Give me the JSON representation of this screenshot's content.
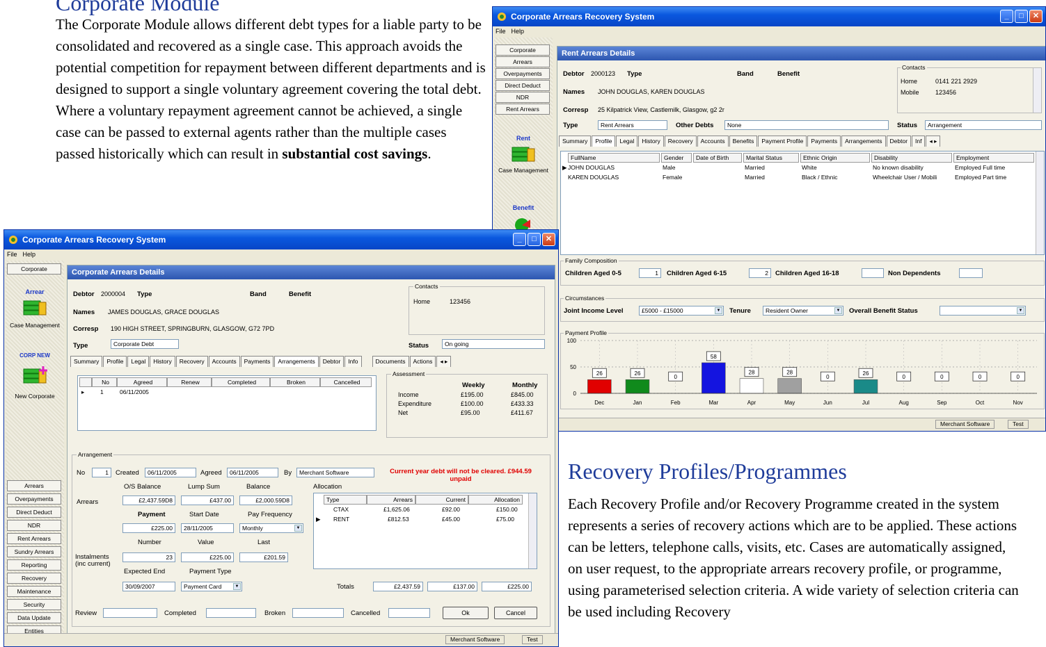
{
  "doc": {
    "heading1": "Corporate Module",
    "para1_before": "The Corporate Module allows different debt types for a liable party to be consolidated and recovered as a single case.  This approach avoids the potential competition for repayment between different departments and is designed to support a single voluntary agreement covering the total debt.  Where a voluntary repayment agreement cannot be achieved, a single case can be passed to external agents rather than the multiple cases passed historically which can result in ",
    "para1_bold": "substantial cost savings",
    "para1_after": ".",
    "heading2": "Recovery Profiles/Programmes",
    "para2": "Each Recovery Profile and/or Recovery Programme created in the system represents a series of recovery actions which are to be applied.  These actions can be letters, telephone calls, visits, etc.  Cases are automatically assigned, on user request, to the appropriate arrears recovery profile, or programme, using parameterised selection criteria.  A wide variety of selection criteria can be used including Recovery"
  },
  "colors": {
    "title_blue": "#0a58df",
    "heading_blue": "#1f3c9a",
    "warning_red": "#e00000"
  },
  "rent_window": {
    "title": "Corporate Arrears Recovery System",
    "menu": [
      "File",
      "Help"
    ],
    "nav_top": [
      "Corporate",
      "Arrears",
      "Overpayments",
      "Direct Deduct",
      "NDR",
      "Rent Arrears"
    ],
    "nav_rent_label": "Rent",
    "nav_case_caption": "Case Management",
    "nav_benefit_label": "Benefit",
    "panel_title": "Rent Arrears Details",
    "debtor_label": "Debtor",
    "debtor_value": "2000123",
    "type_label": "Type",
    "band_label": "Band",
    "benefit_label": "Benefit",
    "names_label": "Names",
    "names_value": "JOHN DOUGLAS, KAREN DOUGLAS",
    "corresp_label": "Corresp",
    "corresp_value": "25 Kilpatrick View, Castlemilk, Glasgow, g2 2r",
    "type2_label": "Type",
    "type2_value": "Rent Arrears",
    "other_debts_label": "Other Debts",
    "other_debts_value": "None",
    "status_label": "Status",
    "status_value": "Arrangement",
    "contacts_caption": "Contacts",
    "contacts": [
      [
        "Home",
        "0141 221 2929"
      ],
      [
        "Mobile",
        "123456"
      ]
    ],
    "tabs": [
      "Summary",
      "Profile",
      "Legal",
      "History",
      "Recovery",
      "Accounts",
      "Benefits",
      "Payment Profile",
      "Payments",
      "Arrangements",
      "Debtor",
      "Inf"
    ],
    "grid_headers": [
      "FullName",
      "Gender",
      "Date of Birth",
      "Marital Status",
      "Ethnic Origin",
      "Disability",
      "Employment"
    ],
    "grid_rows": [
      [
        "JOHN DOUGLAS",
        "Male",
        "",
        "Married",
        "White",
        "No known disability",
        "Employed Full time"
      ],
      [
        "KAREN DOUGLAS",
        "Female",
        "",
        "Married",
        "Black / Ethnic",
        "Wheelchair User / Mobili",
        "Employed Part time"
      ]
    ],
    "family_caption": "Family Composition",
    "family": [
      [
        "Children Aged 0-5",
        "1"
      ],
      [
        "Children Aged 6-15",
        "2"
      ],
      [
        "Children Aged 16-18",
        ""
      ],
      [
        "Non Dependents",
        ""
      ]
    ],
    "circ_caption": "Circumstances",
    "joint_income_label": "Joint Income Level",
    "joint_income_value": "£5000 - £15000",
    "tenure_label": "Tenure",
    "tenure_value": "Resident Owner",
    "overall_label": "Overall Benefit Status",
    "overall_value": "",
    "chart_caption": "Payment Profile",
    "status_bar": [
      "Merchant Software",
      "Test"
    ]
  },
  "chart_data": {
    "type": "bar",
    "title": "Payment Profile",
    "categories": [
      "Dec",
      "Jan",
      "Feb",
      "Mar",
      "Apr",
      "May",
      "Jun",
      "Jul",
      "Aug",
      "Sep",
      "Oct",
      "Nov"
    ],
    "values": [
      26,
      26,
      0,
      58,
      28,
      28,
      0,
      26,
      0,
      0,
      0,
      0
    ],
    "bar_colors": [
      "#e10000",
      "#108a1c",
      "#cccccc",
      "#1414e0",
      "#ffffff",
      "#a0a0a0",
      "#cccccc",
      "#1a8a88",
      "#cccccc",
      "#cccccc",
      "#cccccc",
      "#cccccc"
    ],
    "ylim": [
      0,
      100
    ],
    "yticks": [
      0,
      50,
      100
    ],
    "grid": true,
    "xlabel": "",
    "ylabel": ""
  },
  "corp_window": {
    "title": "Corporate Arrears Recovery System",
    "menu": [
      "File",
      "Help"
    ],
    "nav_top": [
      "Corporate"
    ],
    "nav_arrear_label": "Arrear",
    "nav_case_caption": "Case Management",
    "nav_corp_label": "CORP NEW",
    "nav_corp_caption": "New Corporate",
    "nav_bottom": [
      "Arrears",
      "Overpayments",
      "Direct Deduct",
      "NDR",
      "Rent Arrears",
      "Sundry Arrears",
      "Reporting",
      "Recovery",
      "Maintenance",
      "Security",
      "Data Update",
      "Entities"
    ],
    "panel_title": "Corporate Arrears Details",
    "debtor_label": "Debtor",
    "debtor_value": "2000004",
    "type_label": "Type",
    "band_label": "Band",
    "benefit_label": "Benefit",
    "names_label": "Names",
    "names_value": "JAMES DOUGLAS, GRACE DOUGLAS",
    "corresp_label": "Corresp",
    "corresp_value": "190 HIGH STREET, SPRINGBURN, GLASGOW, G72 7PD",
    "type2_label": "Type",
    "type2_value": "Corporate Debt",
    "status_label": "Status",
    "status_value": "On going",
    "contacts_caption": "Contacts",
    "contacts": [
      [
        "Home",
        "123456"
      ]
    ],
    "tabs": [
      "Summary",
      "Profile",
      "Legal",
      "History",
      "Recovery",
      "Accounts",
      "Payments",
      "Arrangements",
      "Debtor",
      "Info",
      "Documents",
      "Actions"
    ],
    "arr_headers": [
      "No",
      "Agreed",
      "Renew",
      "Completed",
      "Broken",
      "Cancelled"
    ],
    "arr_rows": [
      [
        "1",
        "06/11/2005",
        "",
        "",
        "",
        ""
      ]
    ],
    "assessment_caption": "Assessment",
    "assessment_headers": [
      "Weekly",
      "Monthly"
    ],
    "assessment_rows": [
      [
        "Income",
        "£195.00",
        "£845.00"
      ],
      [
        "Expenditure",
        "£100.00",
        "£433.33"
      ],
      [
        "Net",
        "£95.00",
        "£411.67"
      ]
    ],
    "arrangement_caption": "Arrangement",
    "no_label": "No",
    "no_value": "1",
    "created_label": "Created",
    "created_value": "06/11/2005",
    "agreed_label": "Agreed",
    "agreed_value": "06/11/2005",
    "by_label": "By",
    "by_value": "Merchant Software",
    "warning": "Current year debt will not be cleared. £944.59 unpaid",
    "os_balance_label": "O/S Balance",
    "lump_sum_label": "Lump Sum",
    "balance_label": "Balance",
    "arrears_label": "Arrears",
    "os_balance_value": "£2,437.59D8",
    "lump_sum_value": "£437.00",
    "balance_value": "£2,000.59D8",
    "payment_label": "Payment",
    "start_date_label": "Start Date",
    "pay_freq_label": "Pay Frequency",
    "payment_value": "£225.00",
    "start_date_value": "28/11/2005",
    "pay_freq_value": "Monthly",
    "number_label": "Number",
    "value_label": "Value",
    "last_label": "Last",
    "instalments_label": "Instalments (inc current)",
    "number_value": "23",
    "value_value": "£225.00",
    "last_value": "£201.59",
    "expected_end_label": "Expected End",
    "payment_type_label": "Payment Type",
    "expected_end_value": "30/09/2007",
    "payment_type_value": "Payment Card",
    "allocation_caption": "Allocation",
    "alloc_headers": [
      "Type",
      "Arrears",
      "Current",
      "Allocation"
    ],
    "alloc_rows": [
      [
        "CTAX",
        "£1,625.06",
        "£92.00",
        "£150.00"
      ],
      [
        "RENT",
        "£812.53",
        "£45.00",
        "£75.00"
      ]
    ],
    "totals_label": "Totals",
    "totals": [
      "£2,437.59",
      "£137.00",
      "£225.00"
    ],
    "review_label": "Review",
    "completed_label": "Completed",
    "broken_label": "Broken",
    "cancelled_label": "Cancelled",
    "ok_label": "Ok",
    "cancel_label": "Cancel",
    "status_bar": [
      "Merchant Software",
      "Test"
    ]
  }
}
